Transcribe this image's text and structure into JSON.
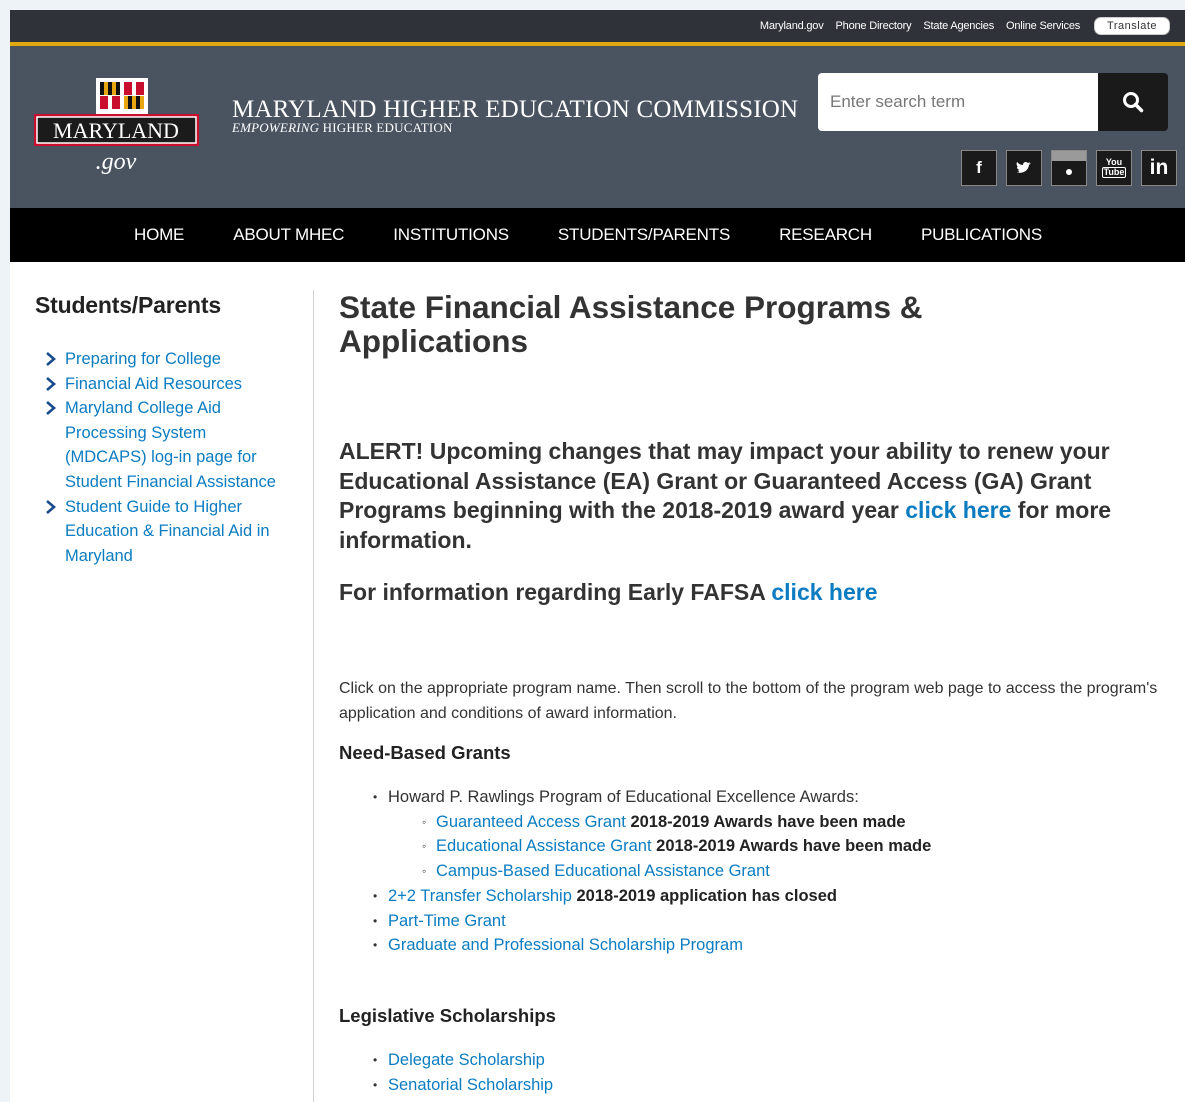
{
  "utility": {
    "links": [
      "Maryland.gov",
      "Phone Directory",
      "State Agencies",
      "Online Services"
    ],
    "translate": "Translate"
  },
  "header": {
    "logo_text": "MARYLAND",
    "logo_sub": ".gov",
    "commission_title": "MARYLAND HIGHER EDUCATION COMMISSION",
    "tagline_em": "EMPOWERING",
    "tagline_rest": "HIGHER EDUCATION",
    "search_placeholder": "Enter search term"
  },
  "social": [
    "f",
    "t",
    "flickr",
    "You Tube",
    "in"
  ],
  "nav": [
    "HOME",
    "ABOUT MHEC",
    "INSTITUTIONS",
    "STUDENTS/PARENTS",
    "RESEARCH",
    "PUBLICATIONS"
  ],
  "sidebar": {
    "title": "Students/Parents",
    "items": [
      "Preparing for College",
      "Financial Aid Resources",
      "Maryland College Aid Processing System (MDCAPS) log-in page for Student Financial Assistance",
      "Student Guide to Higher Education & Financial Aid in Maryland"
    ]
  },
  "main": {
    "title": "State Financial Assistance Programs & Applications",
    "alert_text": "ALERT! Upcoming changes that may impact your ability to renew your Educational Assistance (EA) Grant or Guaranteed Access (GA) Grant Programs beginning with the 2018-2019 award year",
    "alert_link": "click here",
    "alert_tail": "for more information.",
    "fafsa_text": "For information regarding Early FAFSA",
    "fafsa_link": "click here",
    "intro": "Click on the appropriate program name. Then scroll to the bottom of the program web page to access the program's application and conditions of award information.",
    "need_based": {
      "heading": "Need-Based Grants",
      "rawlings": "Howard P. Rawlings Program of Educational Excellence Awards:",
      "ga_link": "Guaranteed Access Grant",
      "ga_note": "2018-2019 Awards have been made",
      "ea_link": "Educational Assistance Grant",
      "ea_note": "2018-2019 Awards have been made",
      "campus_link": "Campus-Based Educational Assistance Grant",
      "transfer_link": "2+2 Transfer Scholarship",
      "transfer_note": "2018-2019 application has closed",
      "parttime_link": "Part-Time Grant",
      "graduate_link": "Graduate and Professional Scholarship Program"
    },
    "legislative": {
      "heading": "Legislative Scholarships",
      "delegate_link": "Delegate Scholarship",
      "senatorial_link": "Senatorial Scholarship"
    }
  }
}
